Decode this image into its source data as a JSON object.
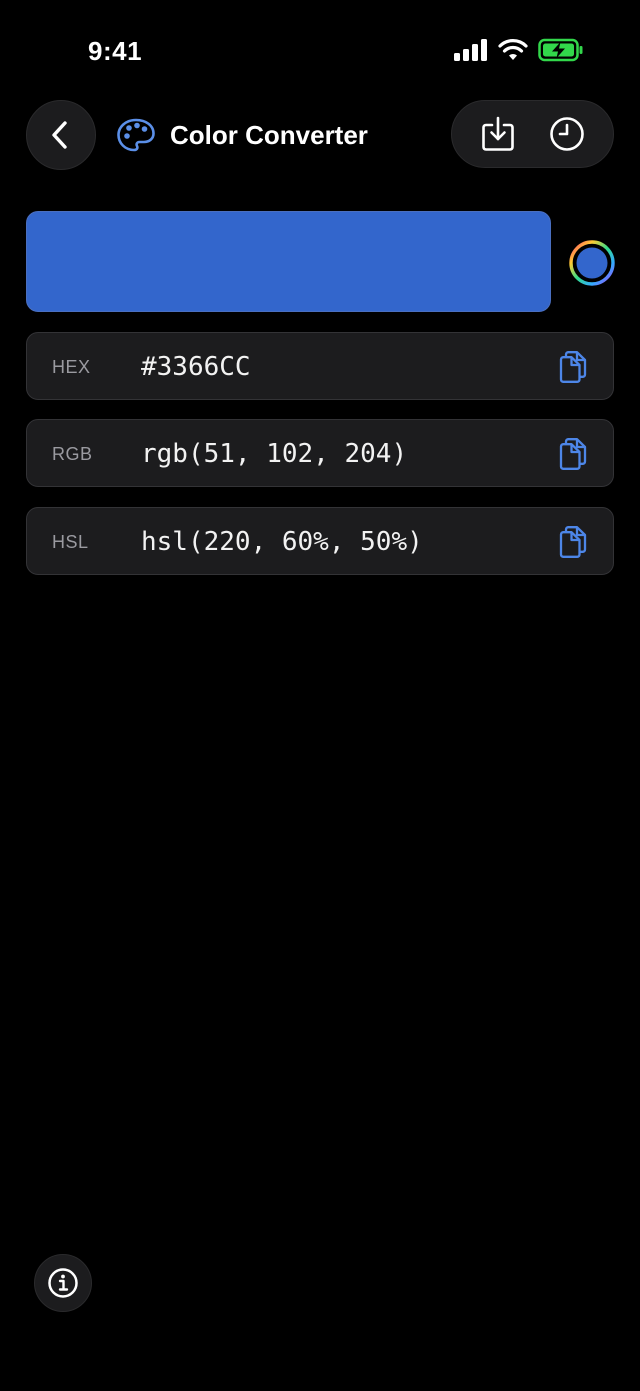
{
  "status_bar": {
    "time": "9:41",
    "icons": [
      "signal-icon",
      "wifi-icon",
      "battery-charging-icon"
    ],
    "battery_color": "#32d74b"
  },
  "header": {
    "title": "Color Converter",
    "icons": {
      "back": "chevron-left-icon",
      "title": "palette-icon",
      "export": "download-icon",
      "history": "clock-icon"
    }
  },
  "color": {
    "swatch_color": "#3366CC",
    "picker_icon": "color-wheel-icon"
  },
  "values": [
    {
      "label": "HEX",
      "value": "#3366CC"
    },
    {
      "label": "RGB",
      "value": "rgb(51, 102, 204)"
    },
    {
      "label": "HSL",
      "value": "hsl(220, 60%, 50%)"
    }
  ],
  "footer": {
    "info_icon": "info-icon"
  },
  "theme": {
    "background": "#000000",
    "card": "#1c1c1e",
    "accent": "#4d86e8"
  }
}
